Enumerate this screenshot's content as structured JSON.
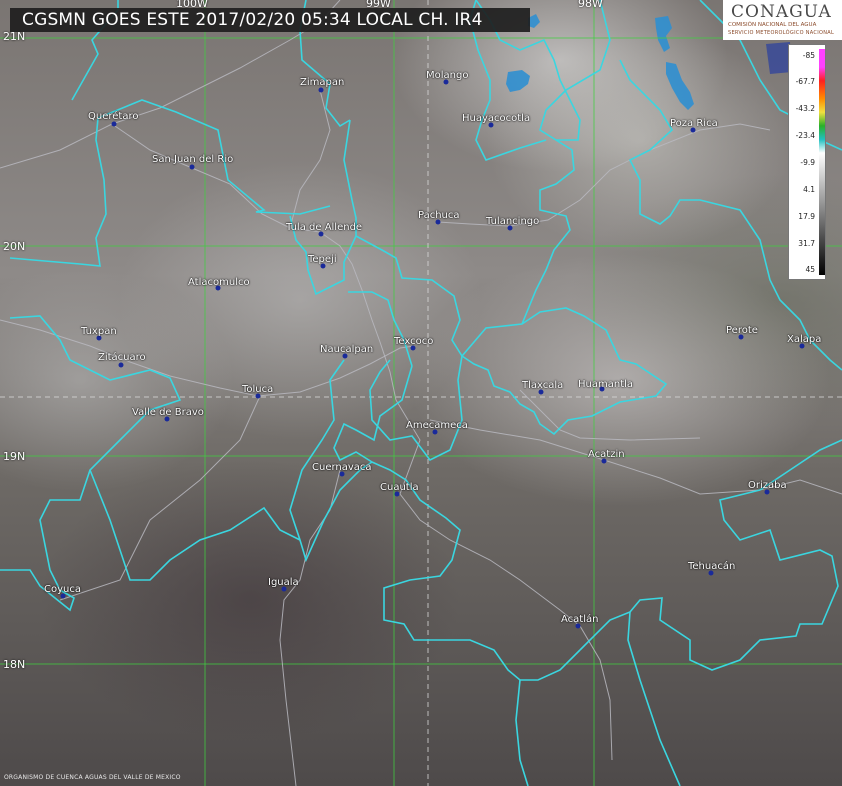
{
  "title": "CGSMN GOES ESTE 2017/02/20 05:34 LOCAL  CH. IR4",
  "logo": {
    "main": "CONAGUA",
    "sub1": "COMISIÓN NACIONAL DEL AGUA",
    "sub2": "SERVICIO METEOROLÓGICO NACIONAL"
  },
  "footer": "ORGANISMO DE CUENCA AGUAS DEL VALLE DE MEXICO",
  "grid_labels": {
    "lon_100": "100W",
    "lon_99": "99W",
    "lon_98": "98W",
    "lat_21": "21N",
    "lat_20": "20N",
    "lat_19": "19N",
    "lat_18": "18N"
  },
  "legend": {
    "labels": [
      "-85",
      "-67.7",
      "-43.2",
      "-23.4",
      "-9.9",
      "4.1",
      "17.9",
      "31.7",
      "45"
    ],
    "colors": {
      "top_pink": "#ff40ff",
      "red": "#ff2020",
      "orange": "#ff8c00",
      "yellow": "#f0e040",
      "green": "#2ab02a",
      "cyan": "#20c0c0",
      "white": "#ffffff",
      "black": "#000000"
    }
  },
  "cities": [
    {
      "name": "Zimapan"
    },
    {
      "name": "Molango"
    },
    {
      "name": "Querétaro"
    },
    {
      "name": "Huayacocotla"
    },
    {
      "name": "Poza Rica"
    },
    {
      "name": "San Juan del Rio"
    },
    {
      "name": "Pachuca"
    },
    {
      "name": "Tulancingo"
    },
    {
      "name": "Tula de Allende"
    },
    {
      "name": "Tepeji"
    },
    {
      "name": "Atlacomulco"
    },
    {
      "name": "Perote"
    },
    {
      "name": "Xalapa"
    },
    {
      "name": "Tuxpan"
    },
    {
      "name": "Texcoco"
    },
    {
      "name": "Naucalpan"
    },
    {
      "name": "Zitácuaro"
    },
    {
      "name": "Tlaxcala"
    },
    {
      "name": "Huamantla"
    },
    {
      "name": "Toluca"
    },
    {
      "name": "Valle de Bravo"
    },
    {
      "name": "Amecameca"
    },
    {
      "name": "Acatzin"
    },
    {
      "name": "Cuernavaca"
    },
    {
      "name": "Orizaba"
    },
    {
      "name": "Cuautla"
    },
    {
      "name": "Tehuacán"
    },
    {
      "name": "Iguala"
    },
    {
      "name": "Coyuca"
    },
    {
      "name": "Acatlán"
    }
  ]
}
